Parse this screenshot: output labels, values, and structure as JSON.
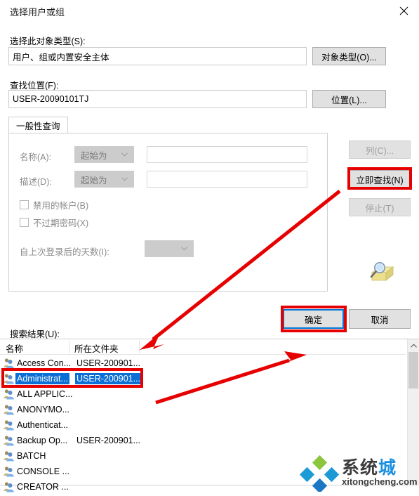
{
  "window": {
    "title": "选择用户或组",
    "close_icon": "close-icon"
  },
  "object_type": {
    "label": "选择此对象类型(S):",
    "value": "用户、组或内置安全主体",
    "button": "对象类型(O)..."
  },
  "location": {
    "label": "查找位置(F):",
    "value": "USER-20090101TJ",
    "button": "位置(L)..."
  },
  "tab": {
    "label": "一般性查询"
  },
  "query": {
    "name_label": "名称(A):",
    "name_condition": "起始为",
    "name_value": "",
    "desc_label": "描述(D):",
    "desc_condition": "起始为",
    "desc_value": "",
    "disabled_accounts": "禁用的帐户(B)",
    "non_expiring_password": "不过期密码(X)",
    "days_label": "自上次登录后的天数(I):",
    "days_value": ""
  },
  "side_buttons": {
    "columns": "列(C)...",
    "find_now": "立即查找(N)",
    "stop": "停止(T)",
    "search_icon": "search-folder-icon"
  },
  "dialog_buttons": {
    "ok": "确定",
    "cancel": "取消"
  },
  "results": {
    "label": "搜索结果(U):",
    "columns": [
      "名称",
      "所在文件夹"
    ],
    "rows": [
      {
        "name": "Access Con...",
        "folder": "USER-200901...",
        "selected": false
      },
      {
        "name": "Administrat...",
        "folder": "USER-200901...",
        "selected": true
      },
      {
        "name": "ALL APPLIC...",
        "folder": "",
        "selected": false
      },
      {
        "name": "ANONYMO...",
        "folder": "",
        "selected": false
      },
      {
        "name": "Authenticat...",
        "folder": "",
        "selected": false
      },
      {
        "name": "Backup Op...",
        "folder": "USER-200901...",
        "selected": false
      },
      {
        "name": "BATCH",
        "folder": "",
        "selected": false
      },
      {
        "name": "CONSOLE ...",
        "folder": "",
        "selected": false
      },
      {
        "name": "CREATOR ...",
        "folder": "",
        "selected": false
      }
    ]
  },
  "watermark": {
    "text_dark": "系统",
    "text_blue": "城",
    "domain": "xitongcheng.com"
  },
  "annotation": {
    "highlight_color": "#e60000",
    "selection_color": "#0b6fd6",
    "focus_color": "#0078d7"
  }
}
